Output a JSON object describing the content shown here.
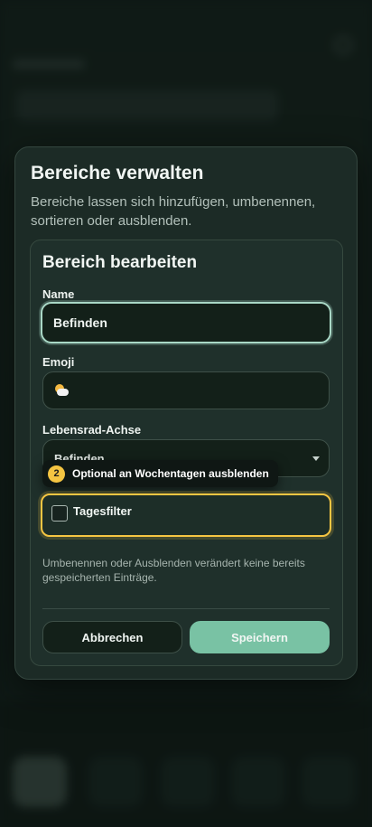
{
  "modal": {
    "title": "Bereiche verwalten",
    "description": "Bereiche lassen sich hinzufügen, umbenennen, sortieren oder ausblenden."
  },
  "panel": {
    "title": "Bereich bearbeiten",
    "name_label": "Name",
    "name_value": "Befinden",
    "emoji_label": "Emoji",
    "emoji_icon": "sun-behind-cloud-icon",
    "axis_label": "Lebensrad-Achse",
    "axis_value": "Befinden",
    "tooltip": {
      "step": "2",
      "text": "Optional an Wochentagen ausblenden"
    },
    "checkbox_label": "Tagesfilter",
    "checkbox_checked": false,
    "hint": "Umbenennen oder Ausblenden verändert keine bereits gespeicherten Einträge.",
    "cancel_label": "Abbrechen",
    "save_label": "Speichern"
  },
  "colors": {
    "accent": "#79c2a4",
    "highlight": "#f5c542",
    "focus_ring": "#a9d8c6"
  }
}
